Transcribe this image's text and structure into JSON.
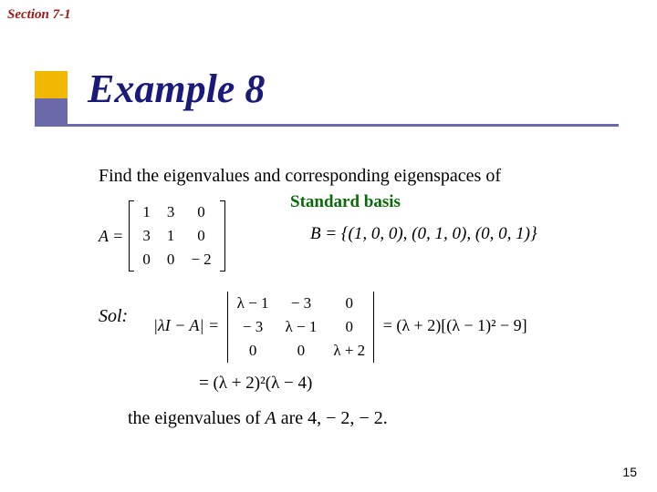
{
  "section": "Section 7-1",
  "title": "Example 8",
  "prompt": "Find the eigenvalues and corresponding eigenspaces of",
  "standard_basis": "Standard basis",
  "matrix_A": {
    "label": "A =",
    "rows": [
      [
        "1",
        "3",
        "0"
      ],
      [
        "3",
        "1",
        "0"
      ],
      [
        "0",
        "0",
        "− 2"
      ]
    ]
  },
  "basis_B": "B = {(1, 0, 0), (0, 1, 0), (0, 0, 1)}",
  "sol_label": "Sol:",
  "det": {
    "lhs": "|λI − A| =",
    "rows": [
      [
        "λ − 1",
        "− 3",
        "0"
      ],
      [
        "− 3",
        "λ − 1",
        "0"
      ],
      [
        "0",
        "0",
        "λ + 2"
      ]
    ],
    "rhs": "= (λ + 2)[(λ − 1)² − 9]"
  },
  "factored": "= (λ + 2)²(λ − 4)",
  "result_prefix": "the eigenvalues of ",
  "result_A": "A",
  "result_suffix": " are 4, − 2, − 2.",
  "page_number": "15"
}
